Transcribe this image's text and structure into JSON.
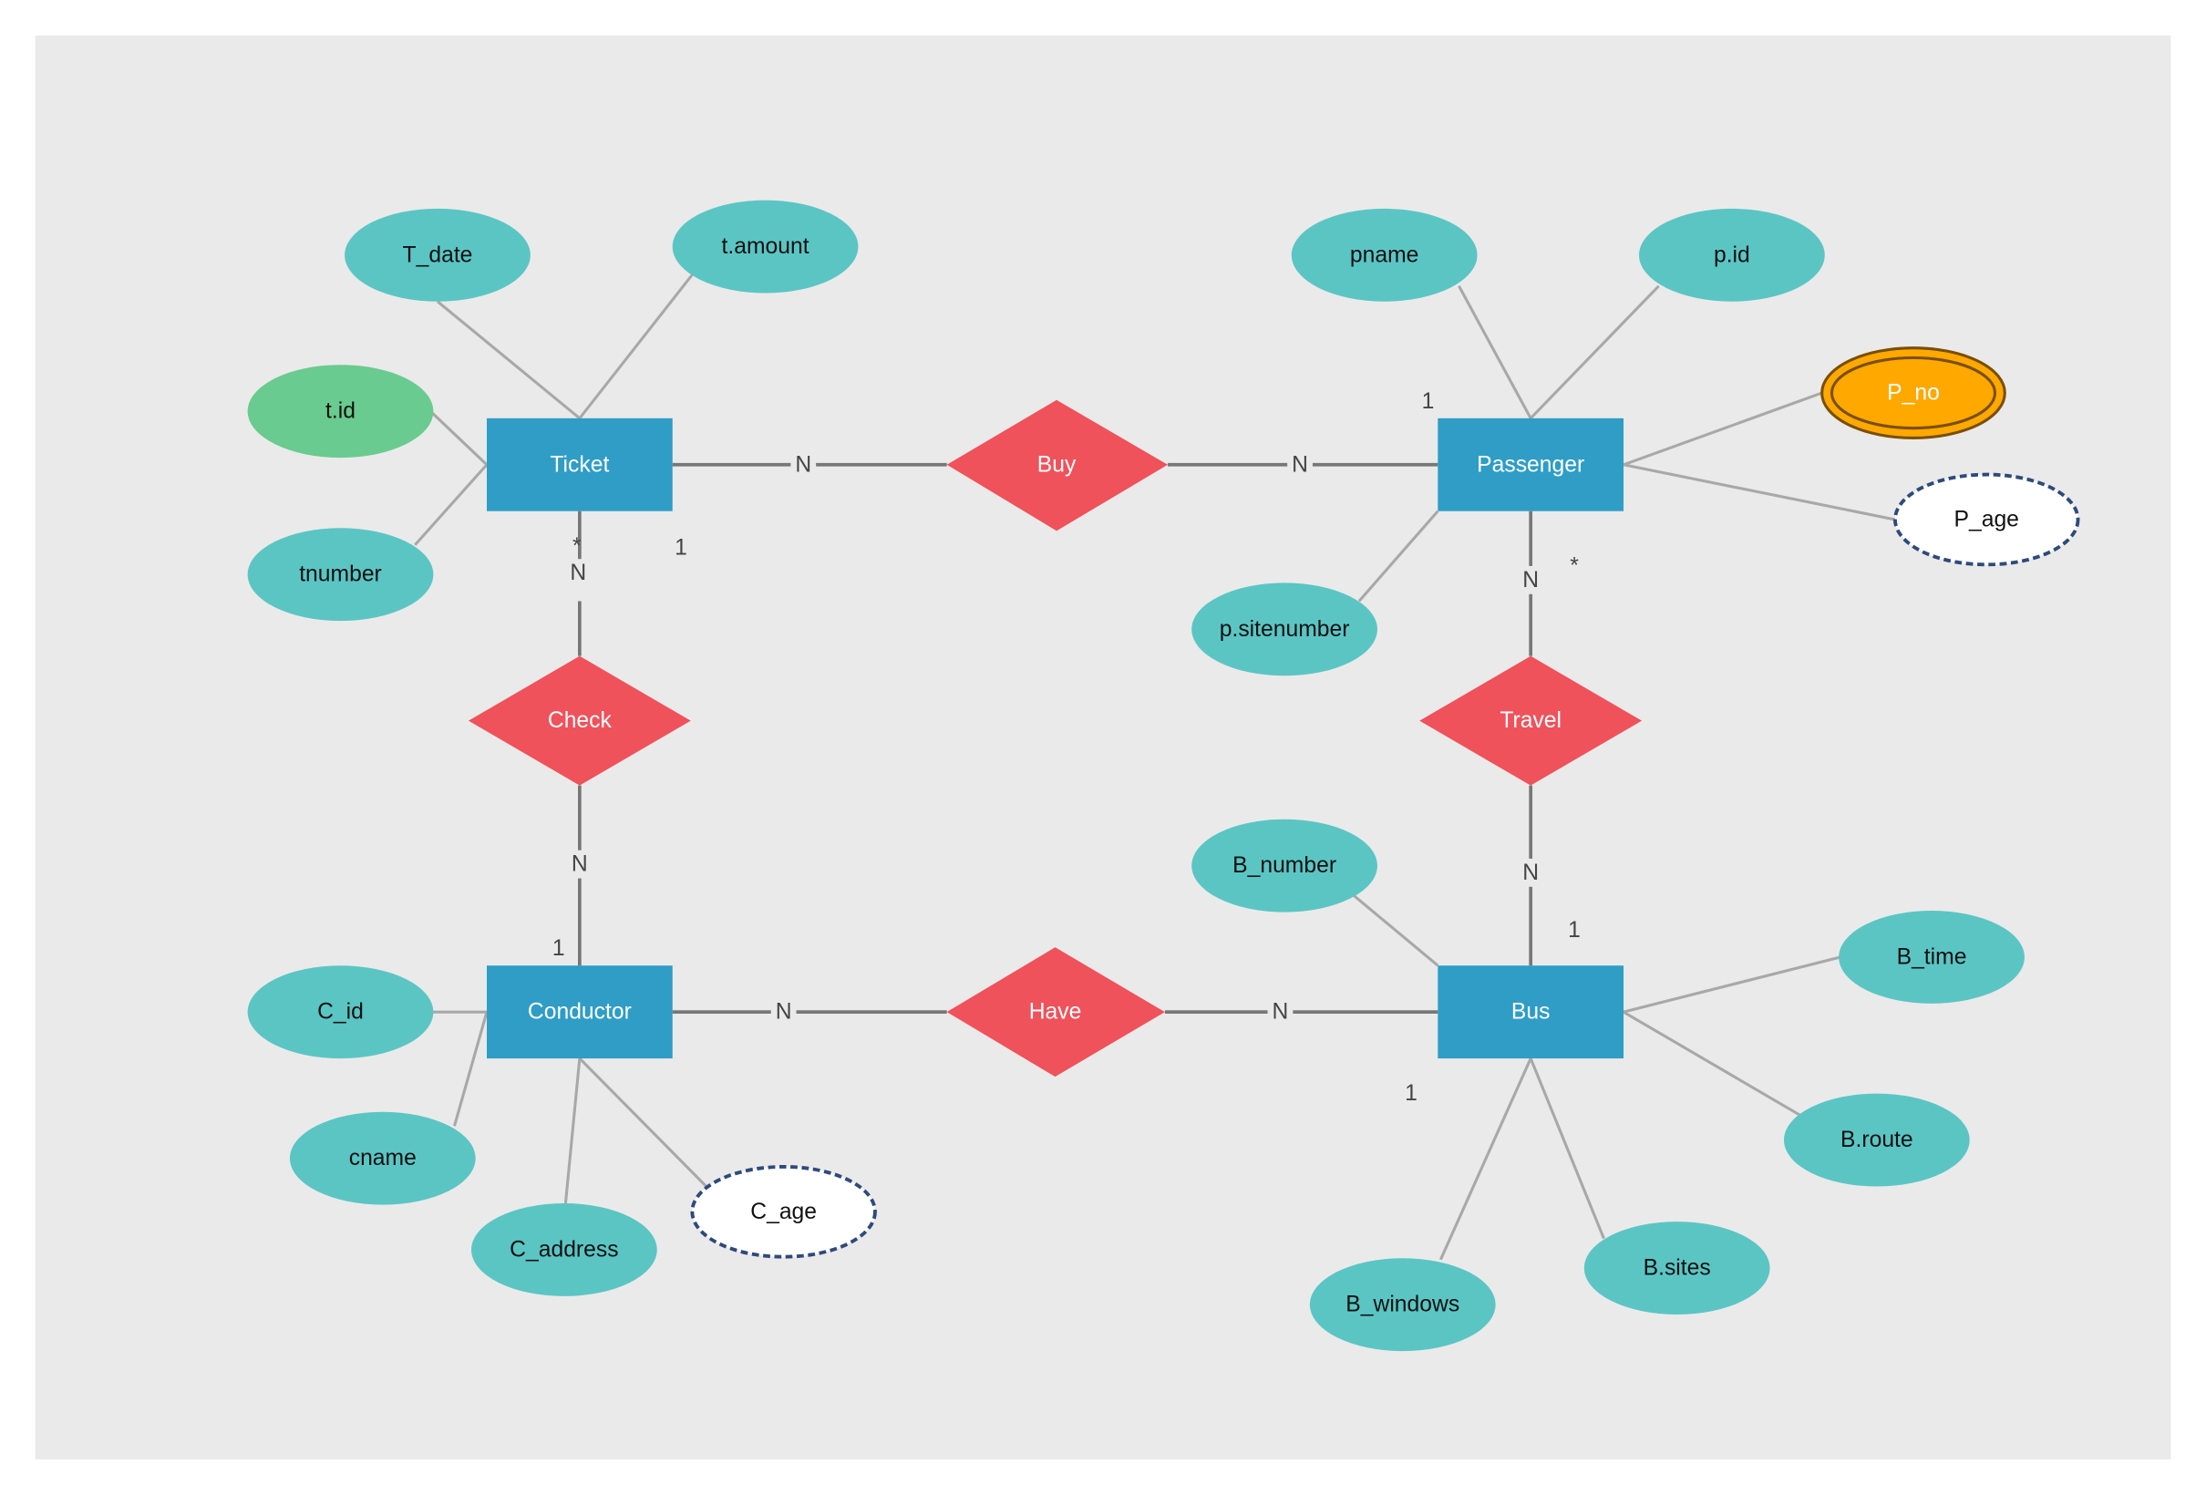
{
  "colors": {
    "background": "#eaeaea",
    "entity": "#2f9dc6",
    "relationship": "#ef525b",
    "attribute": "#5bc5c4",
    "key_attribute": "#69cb8f",
    "multivalued_attribute": "#ffa800",
    "derived_attribute": "#ffffff"
  },
  "entities": {
    "ticket": "Ticket",
    "passenger": "Passenger",
    "conductor": "Conductor",
    "bus": "Bus"
  },
  "relationships": {
    "buy": "Buy",
    "check": "Check",
    "travel": "Travel",
    "have": "Have"
  },
  "attributes": {
    "t_date": "T_date",
    "t_amount": "t.amount",
    "t_id": "t.id",
    "tnumber": "tnumber",
    "pname": "pname",
    "p_id": "p.id",
    "p_no": "P_no",
    "p_age": "P_age",
    "p_sitenumber": "p.sitenumber",
    "b_number": "B_number",
    "b_time": "B_time",
    "b_route": "B.route",
    "b_sites": "B.sites",
    "b_windows": "B_windows",
    "c_id": "C_id",
    "cname": "cname",
    "c_address": "C_address",
    "c_age": "C_age"
  },
  "cardinalities": {
    "ticket_buy": "N",
    "buy_passenger": "N",
    "ticket_check": "N",
    "check_conductor": "N",
    "conductor_have": "N",
    "have_bus": "N",
    "passenger_travel": "N",
    "travel_bus": "N",
    "ticket_one": "1",
    "ticket_star": "*",
    "passenger_one": "1",
    "passenger_star": "*",
    "conductor_one": "1",
    "bus_one_top": "1",
    "bus_one_bottom": "1"
  }
}
